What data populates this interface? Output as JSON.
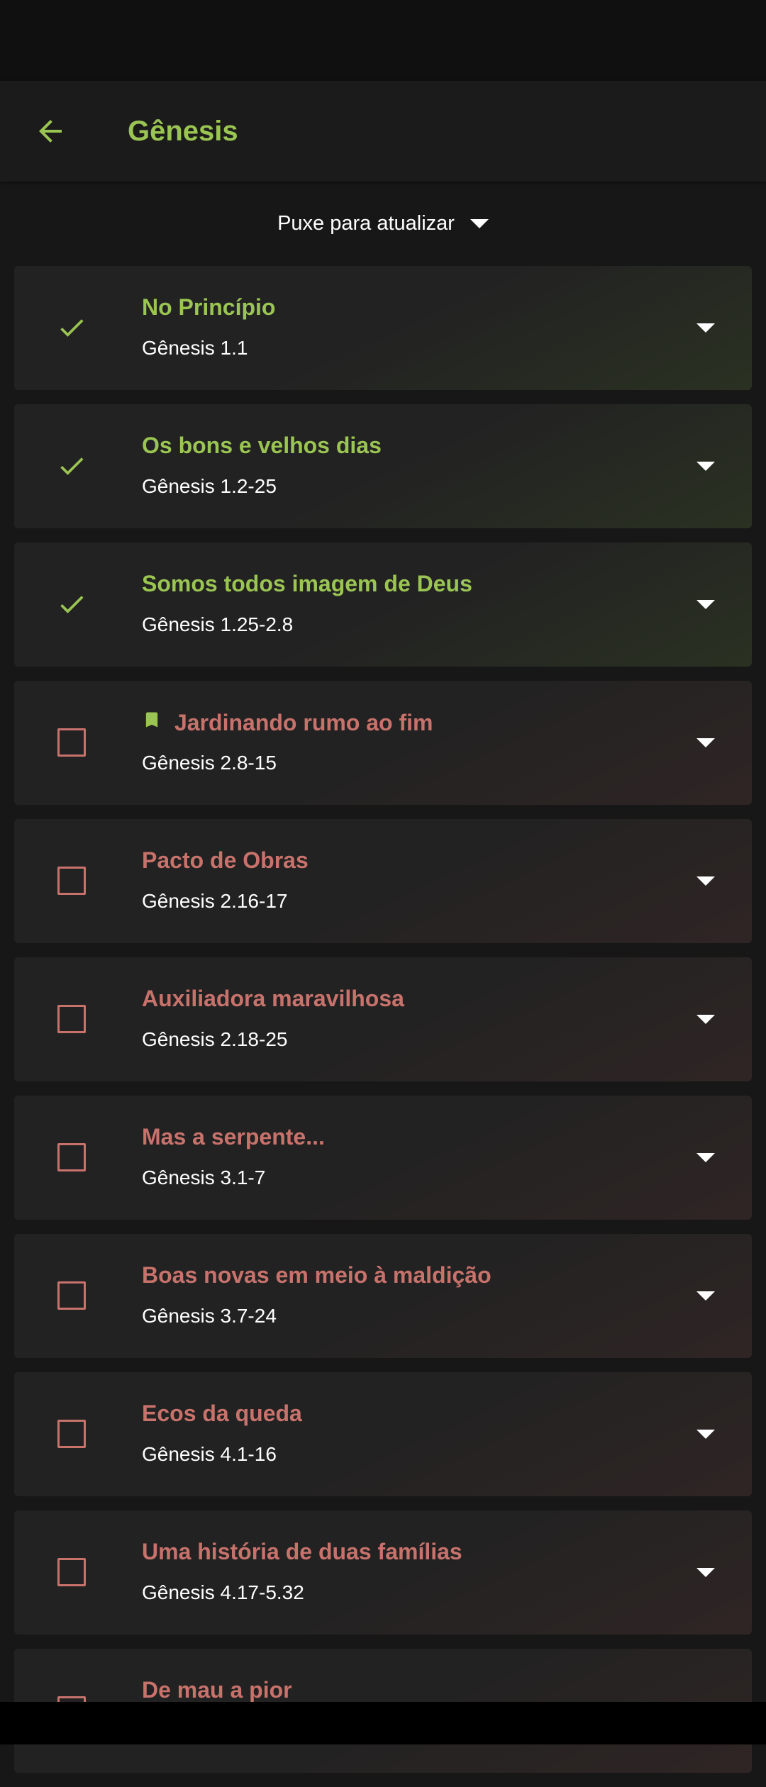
{
  "header": {
    "title": "Gênesis",
    "back_icon": "arrow-left-icon"
  },
  "refresh": {
    "label": "Puxe para atualizar"
  },
  "colors": {
    "accent_done": "#9bc552",
    "accent_todo": "#c8726c",
    "background": "#171717"
  },
  "lessons": [
    {
      "title": "No Princípio",
      "reference": "Gênesis 1.1",
      "completed": true,
      "bookmarked": false
    },
    {
      "title": "Os bons e velhos dias",
      "reference": "Gênesis 1.2-25",
      "completed": true,
      "bookmarked": false
    },
    {
      "title": "Somos todos imagem de Deus",
      "reference": "Gênesis 1.25-2.8",
      "completed": true,
      "bookmarked": false
    },
    {
      "title": "Jardinando rumo ao fim",
      "reference": "Gênesis 2.8-15",
      "completed": false,
      "bookmarked": true
    },
    {
      "title": "Pacto de Obras",
      "reference": "Gênesis 2.16-17",
      "completed": false,
      "bookmarked": false
    },
    {
      "title": "Auxiliadora maravilhosa",
      "reference": "Gênesis 2.18-25",
      "completed": false,
      "bookmarked": false
    },
    {
      "title": "Mas a serpente...",
      "reference": "Gênesis 3.1-7",
      "completed": false,
      "bookmarked": false
    },
    {
      "title": "Boas novas em meio à maldição",
      "reference": "Gênesis 3.7-24",
      "completed": false,
      "bookmarked": false
    },
    {
      "title": "Ecos da queda",
      "reference": "Gênesis 4.1-16",
      "completed": false,
      "bookmarked": false
    },
    {
      "title": "Uma história de duas famílias",
      "reference": "Gênesis 4.17-5.32",
      "completed": false,
      "bookmarked": false
    },
    {
      "title": "De mau a pior",
      "reference": "",
      "completed": false,
      "bookmarked": false
    }
  ]
}
